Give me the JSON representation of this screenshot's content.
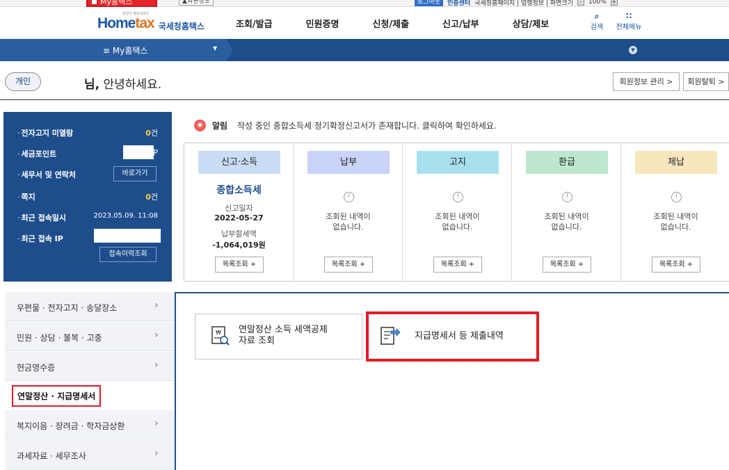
{
  "utility": {
    "my_home_tab": "My홈택스",
    "login_info_btn": "▲회원정보",
    "logout": "로그아웃",
    "cert": "인증센터",
    "links": "국세청홈페이지 | 업행정보 | 화면크기",
    "zoom": "100%"
  },
  "nav": {
    "logo_main_a": "Home",
    "logo_main_b": "tax",
    "logo_sub": "국세청홈택스",
    "logo_tiny": "민원인 정보서비스",
    "menu": [
      "조회/발급",
      "민원증명",
      "신청/제출",
      "신고/납부",
      "상담/제보"
    ],
    "search": "검색",
    "all_menu": "전체메뉴"
  },
  "bluebar": {
    "title": "≡  My홈택스"
  },
  "greeting": {
    "tag": "개인",
    "name_suffix": "님,",
    "hello": " 안녕하세요.",
    "btn_member": "회원정보 관리 >",
    "btn_withdraw": "회원탈퇴 >"
  },
  "summary": {
    "rows": [
      {
        "label": "전자고지 미열람",
        "count": "0",
        "unit": "건"
      },
      {
        "label": "세금포인트",
        "unit": "P"
      },
      {
        "label": "세무서 및 연락처",
        "button": "바로가기"
      },
      {
        "label": "쪽지",
        "count": "0",
        "unit": "건"
      },
      {
        "label": "최근 접속일시",
        "value": "2023.05.09.  11:08"
      },
      {
        "label": "최근 접속 IP"
      }
    ],
    "history_btn": "접속이력조회"
  },
  "notice": {
    "label": "알림",
    "text": "작성 중인 종합소득세 정기확정신고서가 존재합니다. 클릭하여 확인하세요."
  },
  "status": {
    "columns": [
      {
        "head": "신고·소득",
        "color": "#c9dcf3"
      },
      {
        "head": "납부",
        "color": "#c9d2f7"
      },
      {
        "head": "고지",
        "color": "#a8e0ee"
      },
      {
        "head": "환급",
        "color": "#bde8cf"
      },
      {
        "head": "체납",
        "color": "#f8e7bd"
      }
    ],
    "income": {
      "title": "종합소득세",
      "date_label": "신고일자",
      "date": "2022-05-27",
      "amount_label": "납부할세액",
      "amount": "-1,064,019원"
    },
    "empty_line1": "조회된 내역이",
    "empty_line2": "없습니다.",
    "list_btn": "목록조회 +"
  },
  "leftnav": {
    "items": [
      "우편물 · 전자고지 · 송달장소",
      "민원 · 상담 · 불복 · 고충",
      "현금영수증",
      "연말정산 · 지급명세서",
      "복지이음 · 장려금 · 학자금상환",
      "과세자료 · 세무조사"
    ],
    "chev": "›"
  },
  "cards": {
    "yearend_line1": "연말정산 소득 세액공제",
    "yearend_line2": "자료 조회",
    "payment_stmt": "지급명세서 등 제출내역"
  }
}
